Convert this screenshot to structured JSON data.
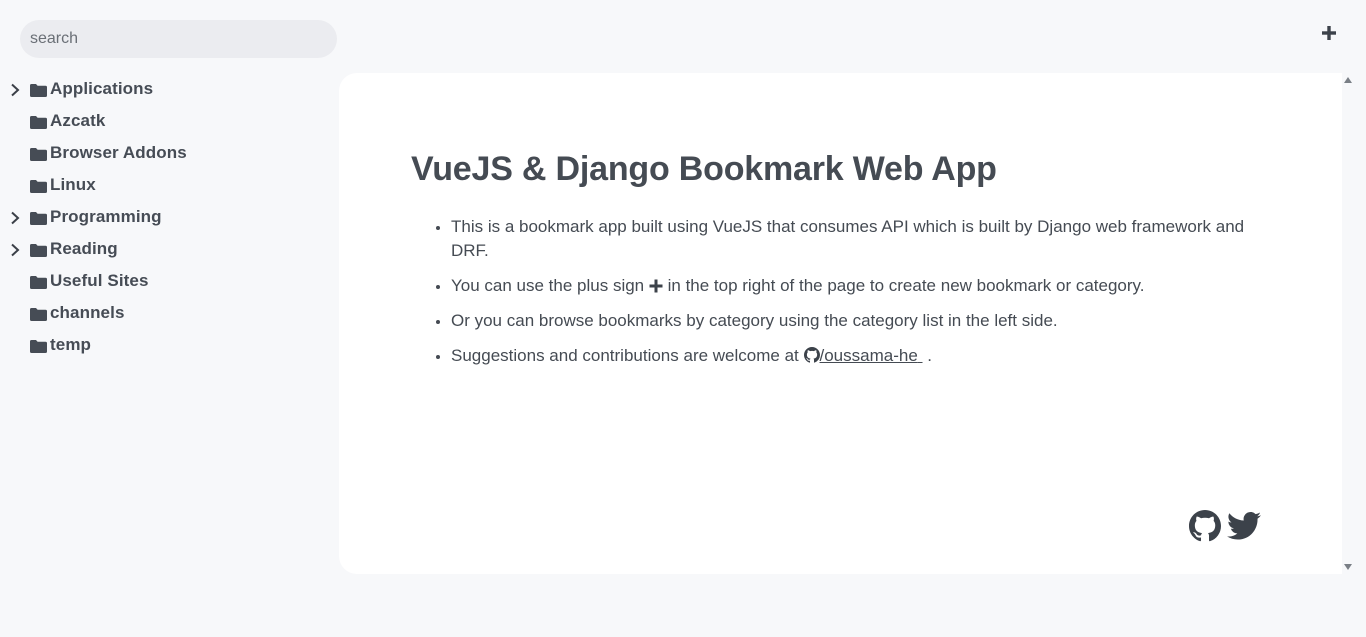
{
  "search": {
    "placeholder": "search"
  },
  "sidebar": {
    "categories": [
      {
        "label": "Applications",
        "expandable": true
      },
      {
        "label": "Azcatk",
        "expandable": false
      },
      {
        "label": "Browser Addons",
        "expandable": false
      },
      {
        "label": "Linux",
        "expandable": false
      },
      {
        "label": "Programming",
        "expandable": true
      },
      {
        "label": "Reading",
        "expandable": true
      },
      {
        "label": "Useful Sites",
        "expandable": false
      },
      {
        "label": "channels",
        "expandable": false
      },
      {
        "label": "temp",
        "expandable": false
      }
    ]
  },
  "header": {
    "add_icon": "plus-icon"
  },
  "main": {
    "title": "VueJS & Django Bookmark Web App",
    "bullets": {
      "b1": "This is a bookmark app built using VueJS that consumes API which is built by Django web framework and DRF.",
      "b2_before": "You can use the plus sign",
      "b2_after": "in the top right of the page to create new bookmark or category.",
      "b3": "Or you can browse bookmarks by category using the category list in the left side.",
      "b4_before": "Suggestions and contributions are welcome at",
      "b4_link": "/oussama-he",
      "b4_after": "."
    },
    "footer_icons": [
      "github-icon",
      "twitter-icon"
    ]
  },
  "colors": {
    "background": "#f7f8fa",
    "card": "#ffffff",
    "text": "#454b53",
    "search_bg": "#ebecf0"
  }
}
